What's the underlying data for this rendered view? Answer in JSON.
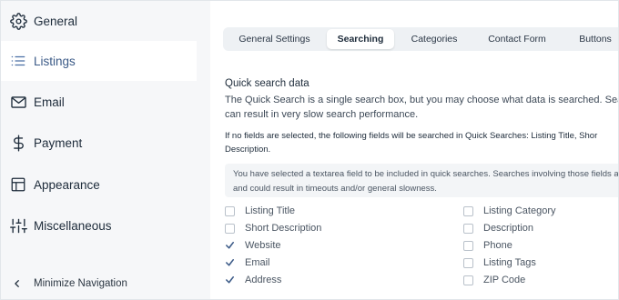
{
  "sidebar": {
    "items": [
      {
        "label": "General",
        "icon": "gear-icon"
      },
      {
        "label": "Listings",
        "icon": "list-icon"
      },
      {
        "label": "Email",
        "icon": "envelope-icon"
      },
      {
        "label": "Payment",
        "icon": "dollar-icon"
      },
      {
        "label": "Appearance",
        "icon": "layout-icon"
      },
      {
        "label": "Miscellaneous",
        "icon": "sliders-icon"
      }
    ],
    "active_index": 1,
    "minimize_label": "Minimize Navigation"
  },
  "tabs": [
    {
      "label": "General Settings"
    },
    {
      "label": "Searching"
    },
    {
      "label": "Categories"
    },
    {
      "label": "Contact Form"
    },
    {
      "label": "Buttons"
    }
  ],
  "active_tab": "Searching",
  "section": {
    "title": "Quick search data",
    "description_line1": "The Quick Search is a single search box, but you may choose what data is searched. Searchin",
    "description_line2": "can result in very slow search performance.",
    "note_line1": "If no fields are selected, the following fields will be searched in Quick Searches: Listing Title, Shor",
    "note_line2": "Description.",
    "warning_line1": "You have selected a textarea field to be included in quick searches. Searches involving those fields ar",
    "warning_line2": "and could result in timeouts and/or general slowness."
  },
  "fields_left": [
    {
      "label": "Listing Title",
      "checked": false
    },
    {
      "label": "Short Description",
      "checked": false
    },
    {
      "label": "Website",
      "checked": true
    },
    {
      "label": "Email",
      "checked": true
    },
    {
      "label": "Address",
      "checked": true
    }
  ],
  "fields_right": [
    {
      "label": "Listing Category",
      "checked": false
    },
    {
      "label": "Description",
      "checked": false
    },
    {
      "label": "Phone",
      "checked": false
    },
    {
      "label": "Listing Tags",
      "checked": false
    },
    {
      "label": "ZIP Code",
      "checked": false
    }
  ],
  "colors": {
    "active_nav_text": "#3b5a87",
    "checkbox_checked": "#3b5a87"
  }
}
